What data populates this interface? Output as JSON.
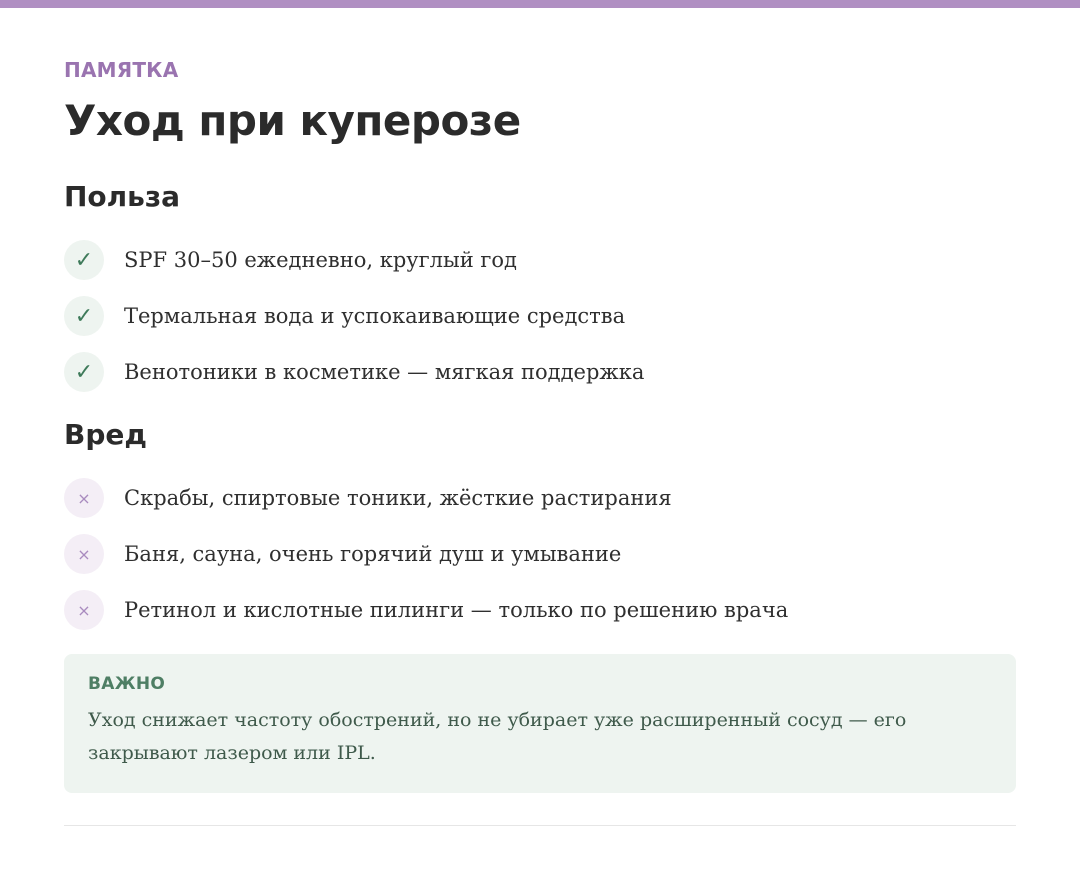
{
  "eyebrow": "ПАМЯТКА",
  "title": "Уход при куперозе",
  "benefit": {
    "heading": "Польза",
    "icon": "check-icon",
    "icon_glyph": "✓",
    "color": "#3e7a5a",
    "items": [
      "SPF 30–50 ежедневно, круглый год",
      "Термальная вода и успокаивающие средства",
      "Венотоники в косметике — мягкая поддержка"
    ]
  },
  "harm": {
    "heading": "Вред",
    "icon": "cross-icon",
    "icon_glyph": "×",
    "color": "#a98bbf",
    "items": [
      "Скрабы, спиртовые тоники, жёсткие растирания",
      "Баня, сауна, очень горячий душ и умывание",
      "Ретинол и кислотные пилинги — только по решению врача"
    ]
  },
  "note": {
    "label": "ВАЖНО",
    "text": "Уход снижает частоту обострений, но не убирает уже расширенный сосуд — его закрывают лазером или IPL."
  },
  "colors": {
    "accent_bar": "#b08fc2",
    "accent_text": "#9a74b0",
    "note_bg": "#eef4f0"
  }
}
